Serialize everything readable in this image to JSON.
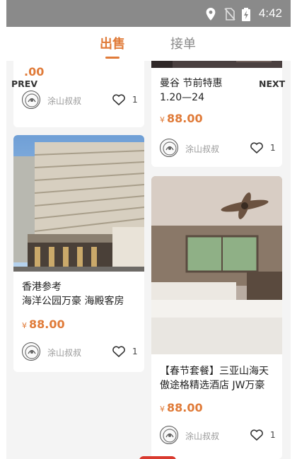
{
  "status": {
    "time": "4:42",
    "icons": [
      "location-icon",
      "no-sim-icon",
      "battery-charging-icon"
    ]
  },
  "tabs": [
    {
      "label": "出售",
      "active": true
    },
    {
      "label": "接单",
      "active": false
    }
  ],
  "nav": {
    "prev": "PREV",
    "next": "NEXT"
  },
  "cards": [
    {
      "id": "c0",
      "title_lines": [],
      "price": ".00",
      "currency": "",
      "author": "涂山叔叔",
      "likes": "1"
    },
    {
      "id": "c1",
      "title_lines": [
        "曼谷 节前特惠",
        "1.20—24"
      ],
      "price": "88.00",
      "currency": "¥",
      "author": "涂山叔叔",
      "likes": "1"
    },
    {
      "id": "c2",
      "title_lines": [
        "香港参考",
        "海洋公园万豪 海殿客房"
      ],
      "price": "88.00",
      "currency": "¥",
      "author": "涂山叔叔",
      "likes": "1"
    },
    {
      "id": "c3",
      "title_lines": [
        "【春节套餐】三亚山海天",
        "傲途格精选酒店 JW万豪"
      ],
      "price": "88.00",
      "currency": "¥",
      "author": "涂山叔叔",
      "likes": "1"
    }
  ],
  "colors": {
    "accent": "#e07b39",
    "statusbar": "#8a8a8a",
    "background": "#f4f4f4"
  }
}
